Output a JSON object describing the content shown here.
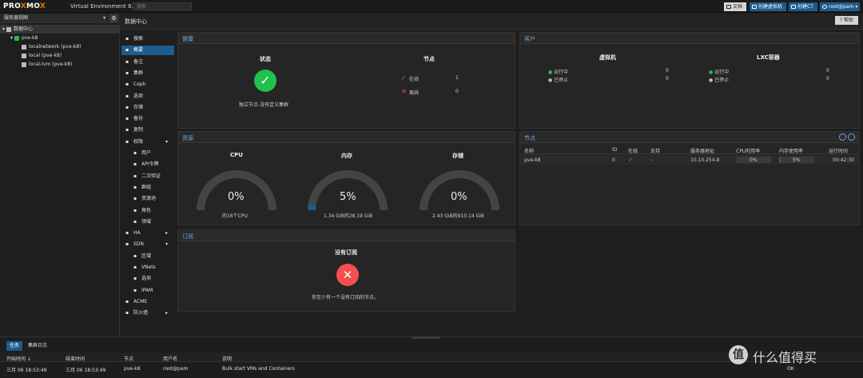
{
  "topbar": {
    "logo_a": "PRO",
    "logo_x": "X",
    "logo_b": "MO",
    "logo_x2": "X",
    "version": "Virtual Environment 8.1.3",
    "search_placeholder": "搜索",
    "doc_label": "文档",
    "create_vm_label": "创建虚拟机",
    "create_ct_label": "创建CT",
    "user_label": "root@pam"
  },
  "tree": {
    "view_label": "服务器视图",
    "items": [
      {
        "label": "数据中心"
      },
      {
        "label": "pve-k8"
      },
      {
        "label": "localnetwork (pve-k8)"
      },
      {
        "label": "local (pve-k8)"
      },
      {
        "label": "local-lvm (pve-k8)"
      }
    ]
  },
  "content": {
    "title": "数据中心",
    "help_label": "帮助"
  },
  "nav": [
    {
      "label": "搜索",
      "icon": "search-icon"
    },
    {
      "label": "概要",
      "icon": "summary-icon"
    },
    {
      "label": "备注",
      "icon": "notes-icon"
    },
    {
      "label": "集群",
      "icon": "cluster-icon"
    },
    {
      "label": "Ceph",
      "icon": "ceph-icon"
    },
    {
      "label": "选项",
      "icon": "gear-icon"
    },
    {
      "label": "存储",
      "icon": "storage-icon"
    },
    {
      "label": "备份",
      "icon": "backup-icon"
    },
    {
      "label": "复制",
      "icon": "replication-icon"
    },
    {
      "label": "权限",
      "icon": "permissions-icon"
    },
    {
      "label": "用户",
      "icon": "user-icon"
    },
    {
      "label": "API令牌",
      "icon": "token-icon"
    },
    {
      "label": "二次验证",
      "icon": "tfa-icon"
    },
    {
      "label": "群组",
      "icon": "group-icon"
    },
    {
      "label": "资源池",
      "icon": "pool-icon"
    },
    {
      "label": "角色",
      "icon": "role-icon"
    },
    {
      "label": "领域",
      "icon": "realm-icon"
    },
    {
      "label": "HA",
      "icon": "ha-icon"
    },
    {
      "label": "SDN",
      "icon": "sdn-icon"
    },
    {
      "label": "区域",
      "icon": "zone-icon"
    },
    {
      "label": "VNets",
      "icon": "vnets-icon"
    },
    {
      "label": "选项",
      "icon": "gear-icon"
    },
    {
      "label": "IPAM",
      "icon": "ipam-icon"
    },
    {
      "label": "ACME",
      "icon": "acme-icon"
    },
    {
      "label": "防火墙",
      "icon": "firewall-icon"
    }
  ],
  "health": {
    "title": "健康",
    "status_title": "状态",
    "status_text": "独立节点-没有定义集群",
    "nodes_title": "节点",
    "online_label": "在线",
    "online_count": "1",
    "offline_label": "离线",
    "offline_count": "0"
  },
  "guests": {
    "title": "客户",
    "vm_title": "虚拟机",
    "lxc_title": "LXC容器",
    "running_label": "运行中",
    "stopped_label": "已停止",
    "vm_running": "0",
    "vm_stopped": "0",
    "lxc_running": "0",
    "lxc_stopped": "0"
  },
  "resources": {
    "title": "资源",
    "cpu_title": "CPU",
    "cpu_value": "0%",
    "cpu_fraction": 0.0,
    "cpu_detail": "的16个CPU",
    "mem_title": "内存",
    "mem_value": "5%",
    "mem_fraction": 0.05,
    "mem_detail": "1.34 GiB的28.19 GiB",
    "storage_title": "存储",
    "storage_value": "0%",
    "storage_fraction": 0.0,
    "storage_detail": "2.43 GiB的910.14 GiB"
  },
  "nodes": {
    "title": "节点",
    "columns": [
      "名称",
      "ID",
      "在线",
      "支持",
      "服务器地址",
      "CPU利用率",
      "内存使用率",
      "运行时间"
    ],
    "row": {
      "name": "pve-k8",
      "id": "0",
      "support": "-",
      "address": "10.10.254.8",
      "cpu": "0%",
      "cpu_fraction": 0.0,
      "mem": "5%",
      "mem_fraction": 0.05,
      "uptime": "00:42:30"
    }
  },
  "subscription": {
    "title": "订阅",
    "heading": "没有订阅",
    "text": "你至少有一个没有订阅的节点。"
  },
  "bottom": {
    "tabs": [
      "任务",
      "集群日志"
    ],
    "columns": [
      "开始时间 ↓",
      "结束时间",
      "节点",
      "用户名",
      "说明"
    ],
    "row": {
      "start": "三月 06 18:53:49",
      "end": "三月 06 18:53:49",
      "node": "pve-k8",
      "user": "root@pam",
      "desc": "Bulk start VMs and Containers",
      "status": "OK"
    }
  },
  "watermark": {
    "site": "值 什么值得买",
    "sub": "SMZDM.COM"
  },
  "colors": {
    "accent": "#1d5c8c",
    "ok": "#21bf4b",
    "error": "#f54f4f",
    "brand_x": "#e57000"
  }
}
